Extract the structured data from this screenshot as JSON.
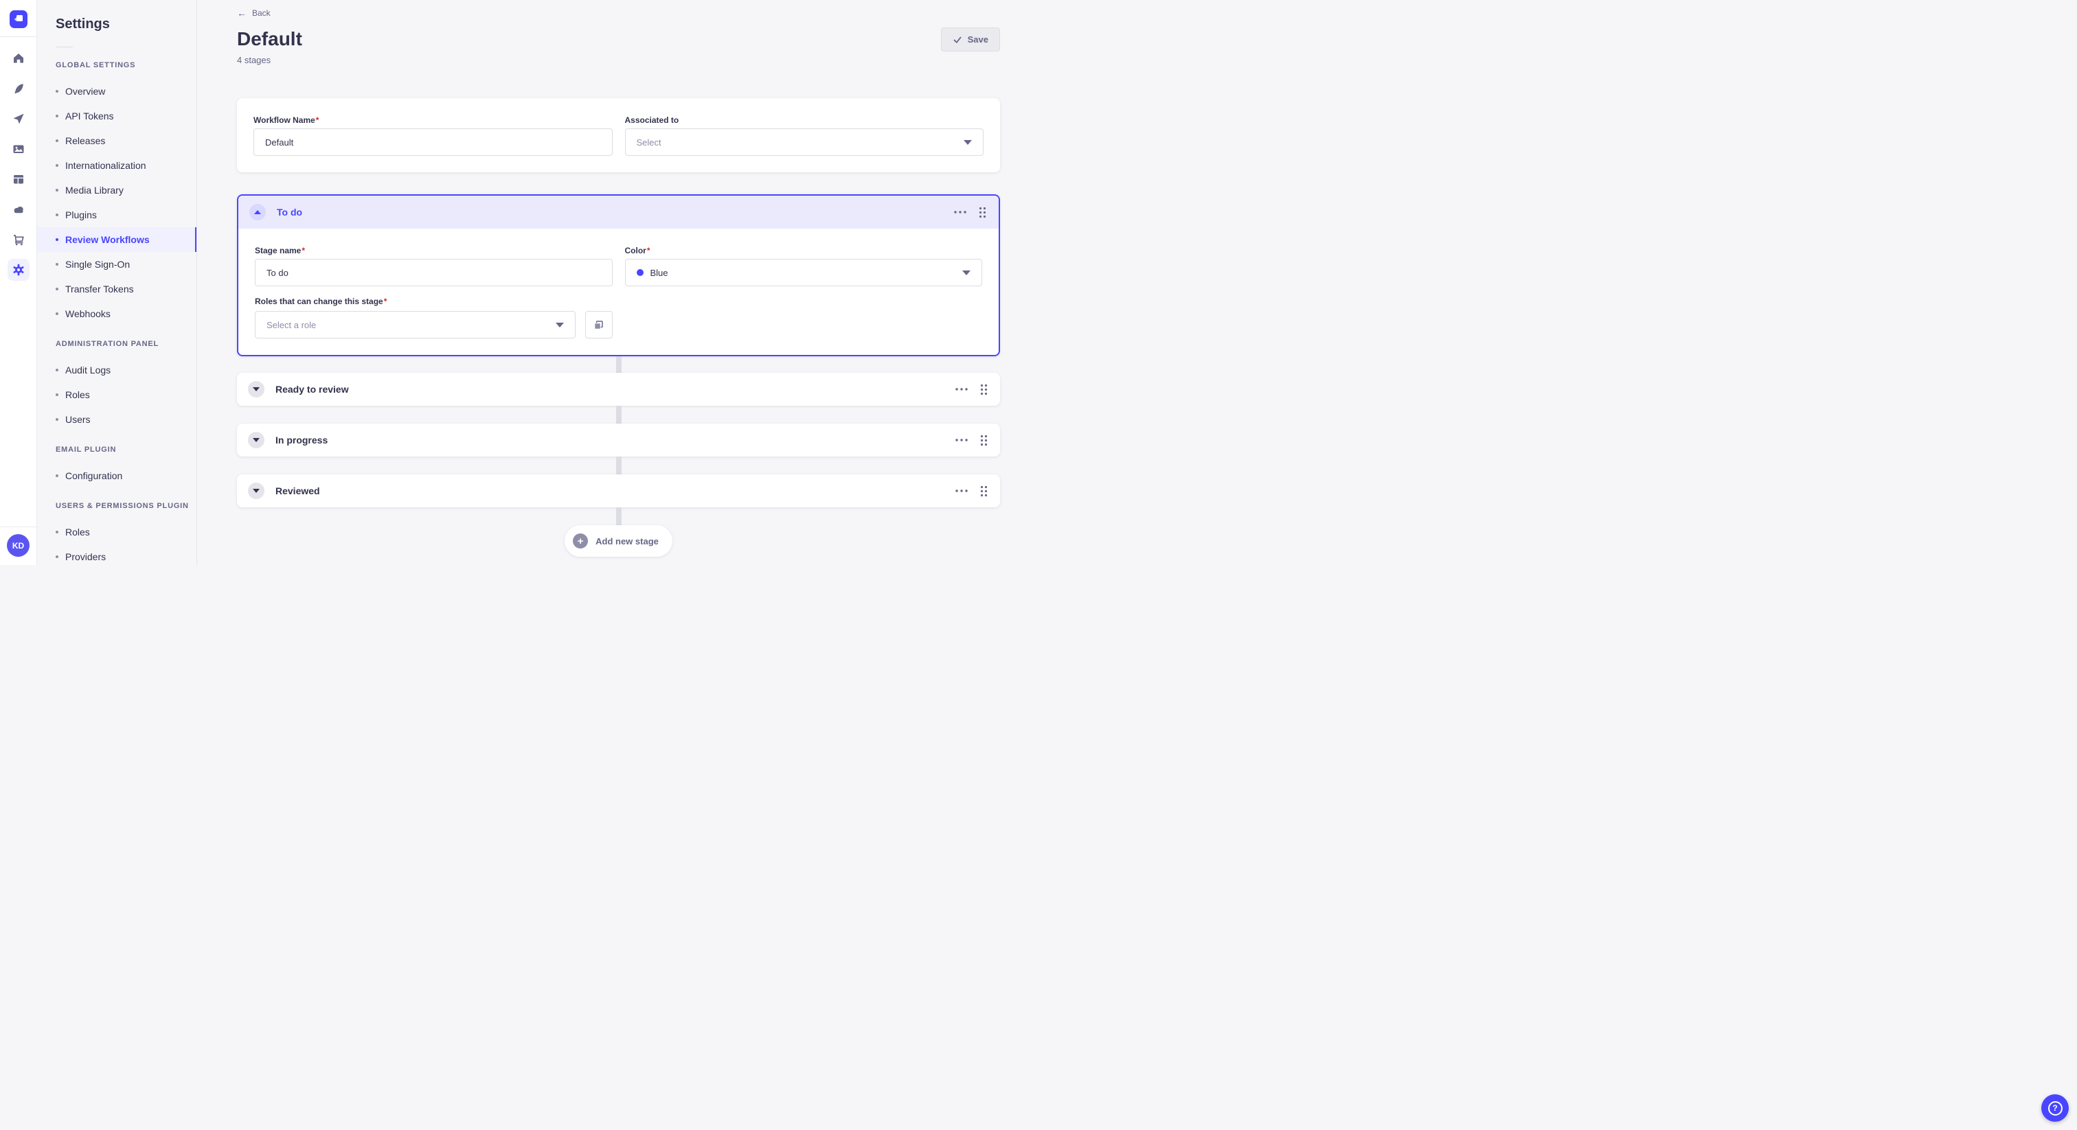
{
  "ui": {
    "required_mark": "*",
    "back_arrow": "←"
  },
  "rail": {
    "avatar_initials": "KD"
  },
  "sidebar": {
    "title": "Settings",
    "active_item": "Review Workflows",
    "sections": [
      {
        "label": "GLOBAL SETTINGS",
        "items": [
          "Overview",
          "API Tokens",
          "Releases",
          "Internationalization",
          "Media Library",
          "Plugins",
          "Review Workflows",
          "Single Sign-On",
          "Transfer Tokens",
          "Webhooks"
        ]
      },
      {
        "label": "ADMINISTRATION PANEL",
        "items": [
          "Audit Logs",
          "Roles",
          "Users"
        ]
      },
      {
        "label": "EMAIL PLUGIN",
        "items": [
          "Configuration"
        ]
      },
      {
        "label": "USERS & PERMISSIONS PLUGIN",
        "items": [
          "Roles",
          "Providers"
        ]
      }
    ]
  },
  "header": {
    "back_label": "Back",
    "title": "Default",
    "subtitle": "4 stages",
    "save_label": "Save"
  },
  "workflow_form": {
    "name_label": "Workflow Name",
    "name_value": "Default",
    "associated_label": "Associated to",
    "associated_placeholder": "Select"
  },
  "stages": {
    "expanded": {
      "title": "To do",
      "name_label": "Stage name",
      "name_value": "To do",
      "color_label": "Color",
      "color_value": "Blue",
      "color_swatch": "#4945ff",
      "roles_label": "Roles that can change this stage",
      "roles_placeholder": "Select a role"
    },
    "collapsed": [
      {
        "title": "Ready to review"
      },
      {
        "title": "In progress"
      },
      {
        "title": "Reviewed"
      }
    ]
  },
  "footer": {
    "add_stage_label": "Add new stage",
    "add_icon": "+",
    "help_icon": "?"
  },
  "colors": {
    "primary": "#4945ff",
    "text": "#32324d",
    "muted": "#666687",
    "placeholder": "#8e8ea9",
    "danger": "#d02b20"
  }
}
